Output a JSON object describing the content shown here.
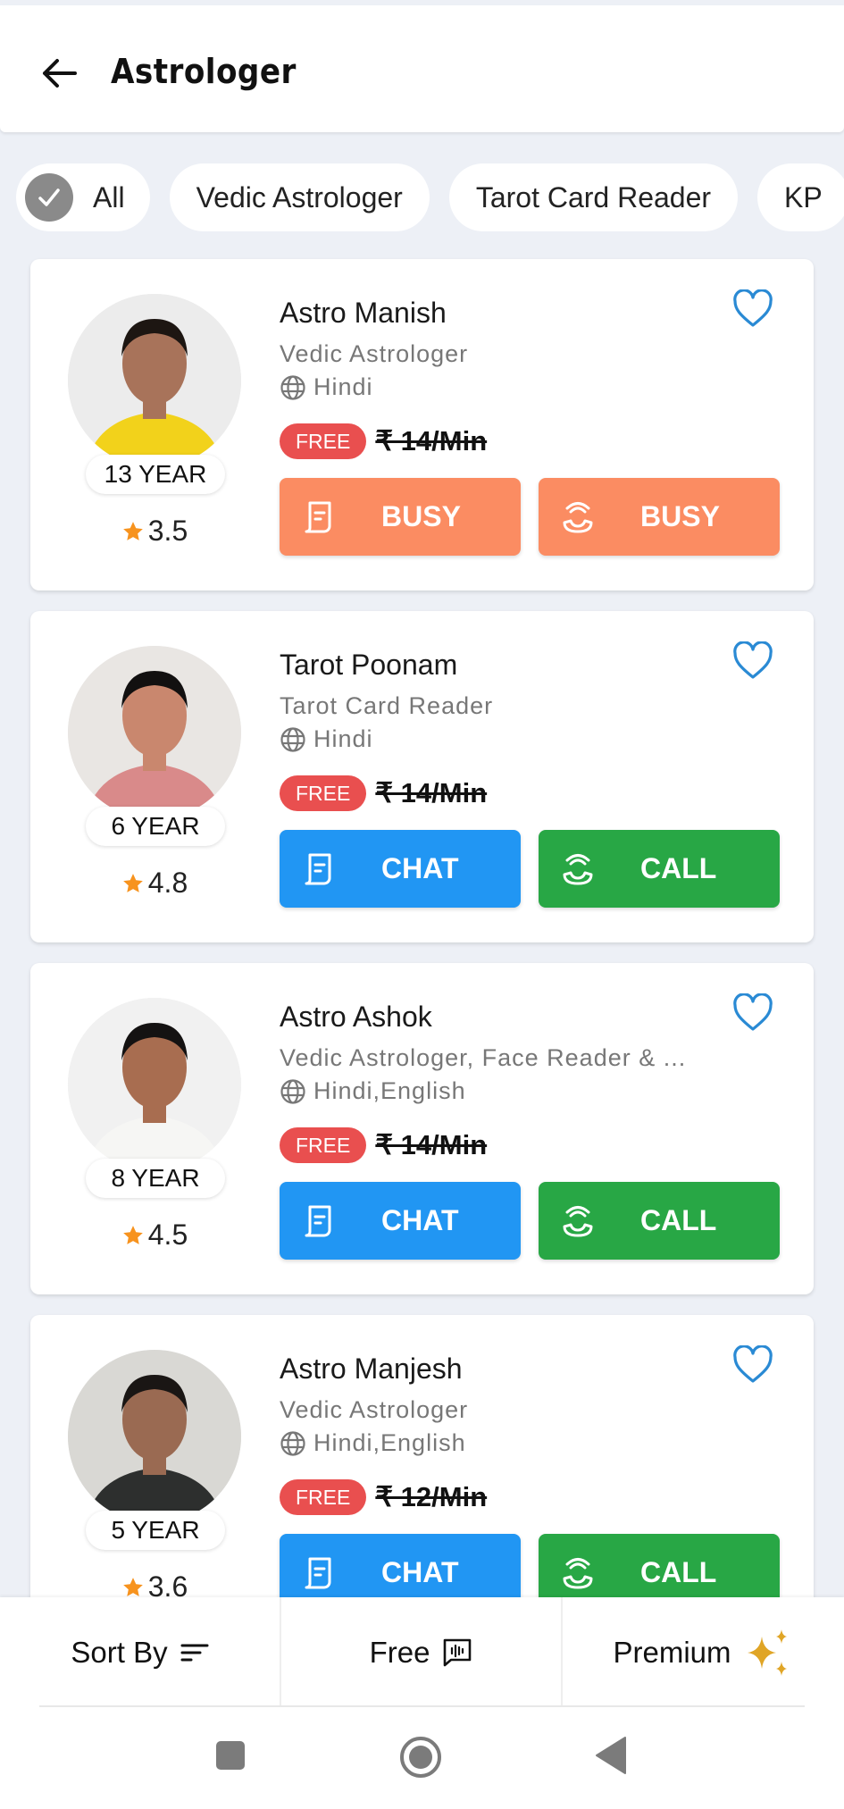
{
  "header": {
    "title": "Astrologer",
    "back_icon": "arrow-left-icon"
  },
  "filters": [
    {
      "label": "All",
      "selected": true
    },
    {
      "label": "Vedic Astrologer",
      "selected": false
    },
    {
      "label": "Tarot Card Reader",
      "selected": false
    },
    {
      "label": "KP",
      "selected": false
    }
  ],
  "colors": {
    "busy": "#fb8c62",
    "chat": "#2196f3",
    "call": "#28a745",
    "free_badge": "#e94f4f",
    "heart": "#2a8ad4",
    "star": "#f7931e",
    "premium": "#e0a526"
  },
  "astrologers": [
    {
      "name": "Astro Manish",
      "specialty": "Vedic Astrologer",
      "languages": "Hindi",
      "experience": "13 YEAR",
      "rating": "3.5",
      "free_label": "FREE",
      "price": "₹ 14/Min",
      "chat_label": "BUSY",
      "call_label": "BUSY",
      "status": "busy",
      "photo": {
        "bg": "#ececec",
        "skin": "#a8735a",
        "shirt": "#f2d21b",
        "hair": "#1d1612"
      }
    },
    {
      "name": "Tarot Poonam",
      "specialty": "Tarot Card Reader",
      "languages": "Hindi",
      "experience": "6 YEAR",
      "rating": "4.8",
      "free_label": "FREE",
      "price": "₹ 14/Min",
      "chat_label": "CHAT",
      "call_label": "CALL",
      "status": "online",
      "photo": {
        "bg": "#e9e6e3",
        "skin": "#c9876e",
        "shirt": "#d98a8a",
        "hair": "#121010"
      }
    },
    {
      "name": "Astro Ashok",
      "specialty": "Vedic Astrologer, Face Reader & ...",
      "languages": "Hindi,English",
      "experience": "8 YEAR",
      "rating": "4.5",
      "free_label": "FREE",
      "price": "₹ 14/Min",
      "chat_label": "CHAT",
      "call_label": "CALL",
      "status": "online",
      "photo": {
        "bg": "#f1f1f1",
        "skin": "#a86d50",
        "shirt": "#f6f6f4",
        "hair": "#141212"
      }
    },
    {
      "name": "Astro Manjesh",
      "specialty": "Vedic Astrologer",
      "languages": "Hindi,English",
      "experience": "5 YEAR",
      "rating": "3.6",
      "free_label": "FREE",
      "price": "₹ 12/Min",
      "chat_label": "CHAT",
      "call_label": "CALL",
      "status": "online",
      "photo": {
        "bg": "#d9d8d4",
        "skin": "#9a6a52",
        "shirt": "#2d2f2e",
        "hair": "#1a1614"
      }
    }
  ],
  "bottom_bar": {
    "sort_label": "Sort By",
    "free_label": "Free",
    "premium_label": "Premium"
  }
}
